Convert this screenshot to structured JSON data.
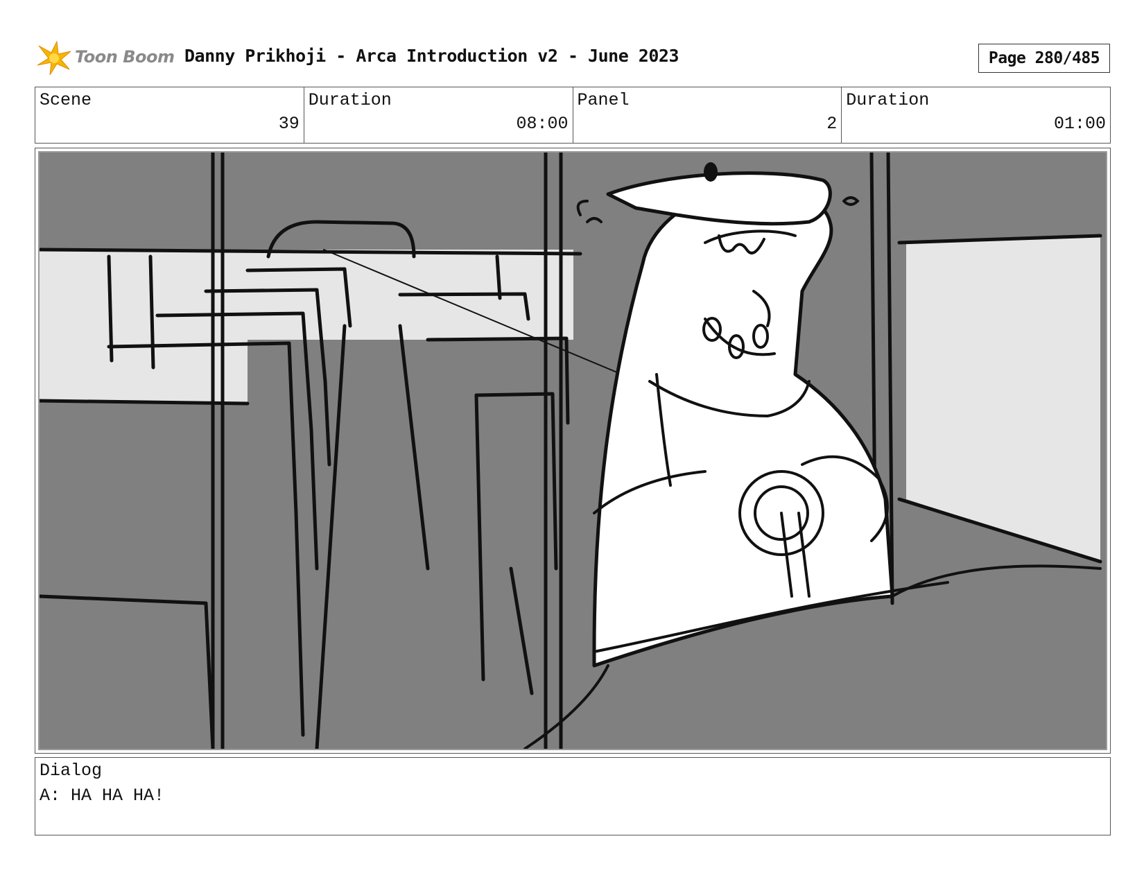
{
  "header": {
    "logo_text": "Toon Boom",
    "title": "Danny Prikhoji - Arca Introduction v2 - June 2023",
    "page": "Page 280/485"
  },
  "info": {
    "scene_label": "Scene",
    "scene_value": "39",
    "scene_duration_label": "Duration",
    "scene_duration_value": "08:00",
    "panel_label": "Panel",
    "panel_value": "2",
    "panel_duration_label": "Duration",
    "panel_duration_value": "01:00"
  },
  "dialog": {
    "label": "Dialog",
    "text": "A: HA HA HA!"
  },
  "colors": {
    "panel_gray": "#808080",
    "window_light": "#e6e6e6",
    "ink": "#111111",
    "logo_yellow": "#f7b500"
  }
}
